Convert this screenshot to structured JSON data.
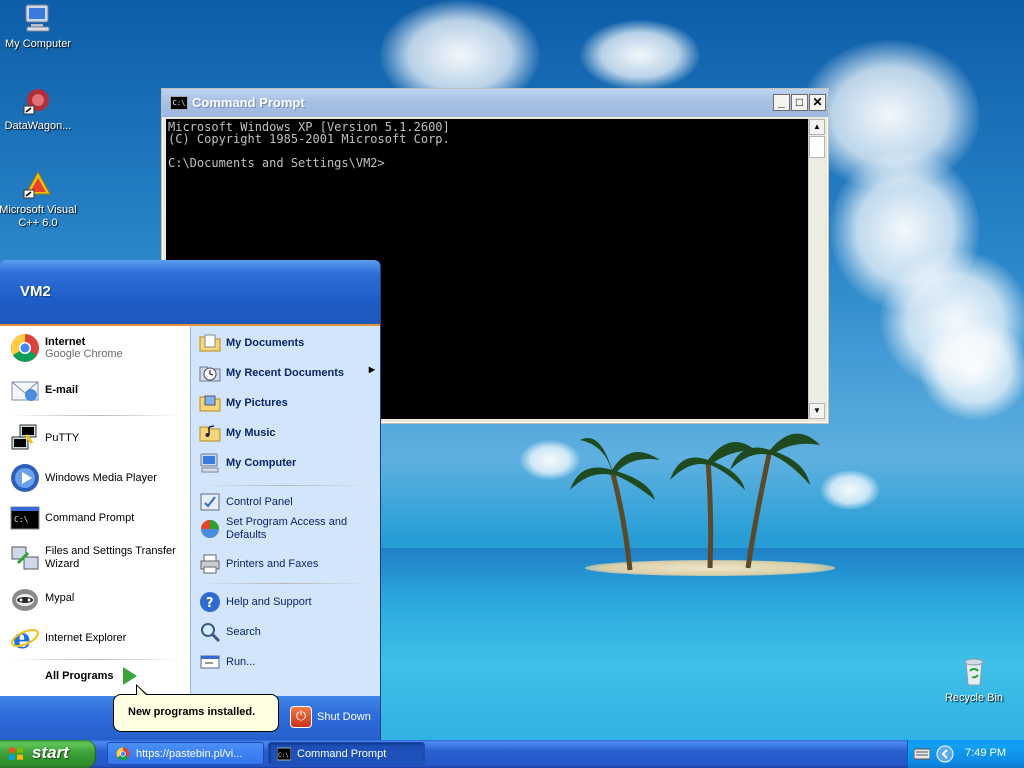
{
  "desktop": {
    "icons": [
      {
        "label": "My Computer"
      },
      {
        "label": "DataWagon..."
      },
      {
        "label": "Microsoft Visual C++ 6.0"
      },
      {
        "label": "Recycle Bin"
      }
    ]
  },
  "cmd_window": {
    "title": "Command Prompt",
    "icon_text": "C:\\",
    "minimize": "_",
    "maximize": "□",
    "close": "✕",
    "lines": [
      "Microsoft Windows XP [Version 5.1.2600]",
      "(C) Copyright 1985-2001 Microsoft Corp.",
      "",
      "C:\\Documents and Settings\\VM2>"
    ]
  },
  "start_menu": {
    "user": "VM2",
    "pinned": [
      {
        "label": "Internet",
        "sub": "Google Chrome"
      },
      {
        "label": "E-mail"
      }
    ],
    "recent": [
      {
        "label": "PuTTY"
      },
      {
        "label": "Windows Media Player"
      },
      {
        "label": "Command Prompt"
      },
      {
        "label": "Files and Settings Transfer Wizard"
      },
      {
        "label": "Mypal"
      },
      {
        "label": "Internet Explorer"
      }
    ],
    "all_programs": "All Programs",
    "right_top": [
      {
        "label": "My Documents"
      },
      {
        "label": "My Recent Documents"
      },
      {
        "label": "My Pictures"
      },
      {
        "label": "My Music"
      },
      {
        "label": "My Computer"
      }
    ],
    "right_mid": [
      {
        "label": "Control Panel"
      },
      {
        "label": "Set Program Access and Defaults"
      },
      {
        "label": "Printers and Faxes"
      }
    ],
    "right_bottom": [
      {
        "label": "Help and Support"
      },
      {
        "label": "Search"
      },
      {
        "label": "Run..."
      }
    ],
    "shutdown": "Shut Down",
    "balloon": "New programs installed."
  },
  "taskbar": {
    "start": "start",
    "buttons": [
      {
        "label": "https://pastebin.pl/vi..."
      },
      {
        "label": "Command Prompt"
      }
    ],
    "clock": "7:49 PM"
  },
  "colors": {
    "xp_blue": "#2458c8",
    "start_green": "#3a9d35",
    "menu_right_bg": "#d3e5fa"
  }
}
